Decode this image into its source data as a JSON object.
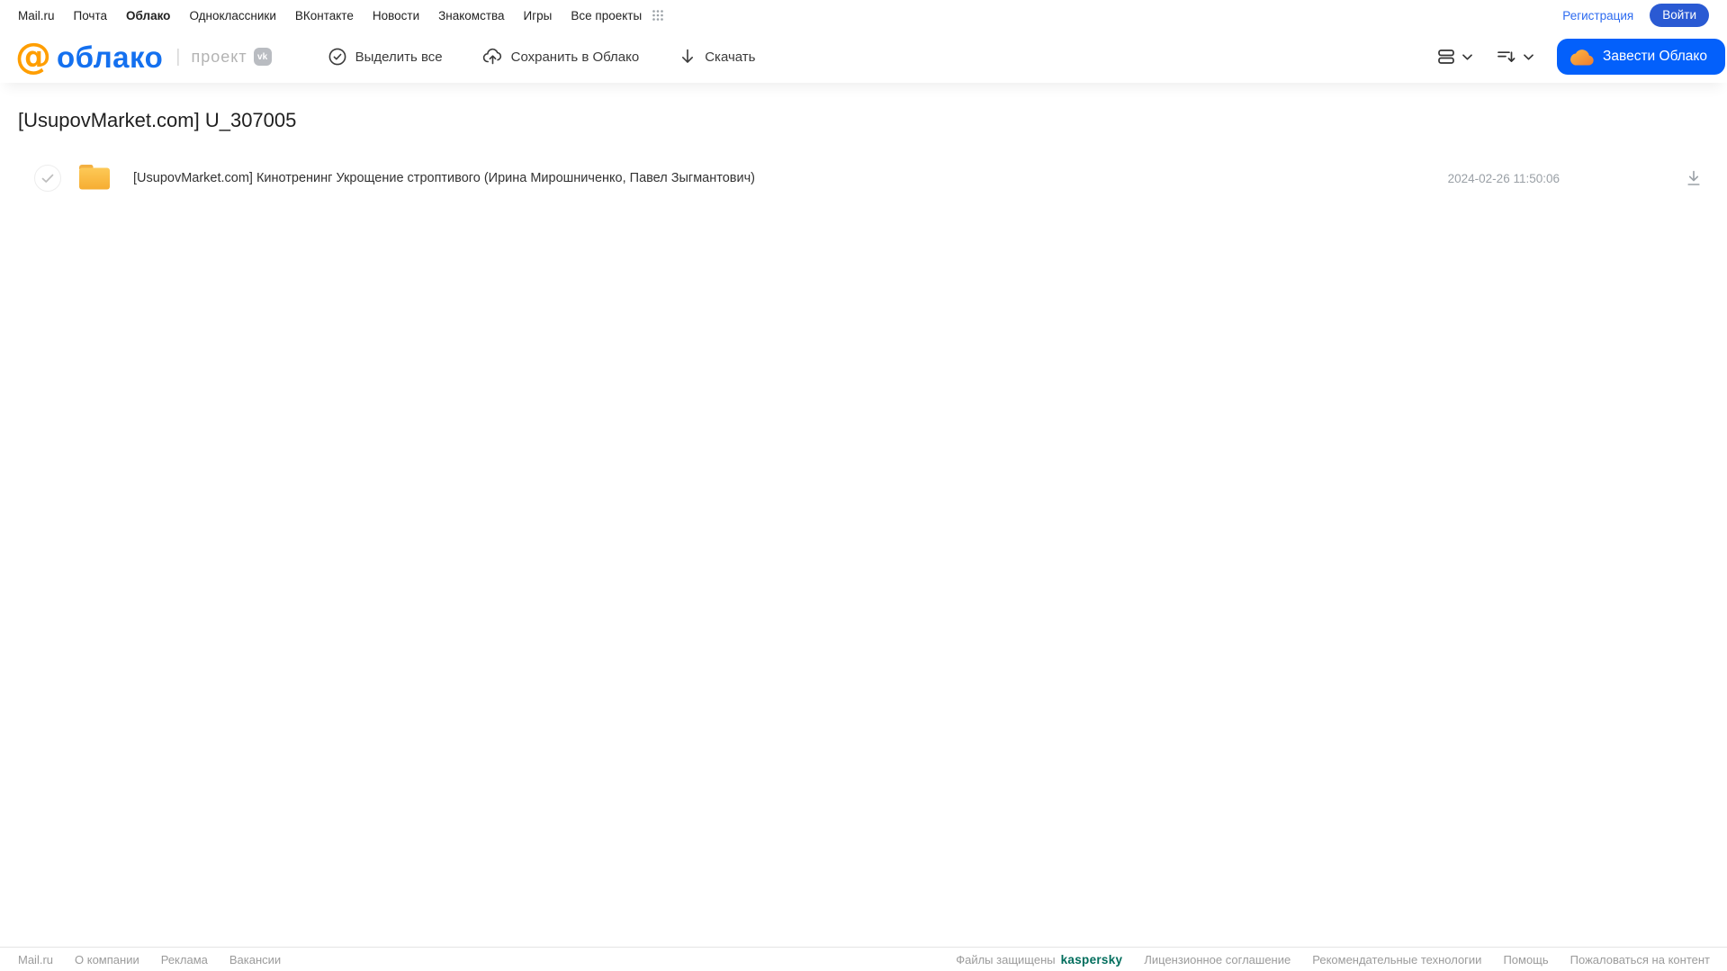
{
  "topnav": {
    "links": [
      {
        "label": "Mail.ru"
      },
      {
        "label": "Почта"
      },
      {
        "label": "Облако"
      },
      {
        "label": "Одноклассники"
      },
      {
        "label": "ВКонтакте"
      },
      {
        "label": "Новости"
      },
      {
        "label": "Знакомства"
      },
      {
        "label": "Игры"
      },
      {
        "label": "Все проекты"
      }
    ],
    "registration_label": "Регистрация",
    "login_label": "Войти"
  },
  "header": {
    "logo_at": "@",
    "logo_text": "облако",
    "project_label": "проект",
    "vk_badge": "vk",
    "toolbar": {
      "select_all": "Выделить все",
      "save_to_cloud": "Сохранить в Облако",
      "download": "Скачать"
    },
    "create_cloud_label": "Завести Облако"
  },
  "content": {
    "title": "[UsupovMarket.com] U_307005",
    "files": [
      {
        "type": "folder",
        "name": "[UsupovMarket.com] Кинотренинг Укрощение строптивого (Ирина Мирошниченко, Павел Зыгмантович)",
        "date": "2024-02-26 11:50:06"
      }
    ]
  },
  "footer": {
    "left_links": [
      "Mail.ru",
      "О компании",
      "Реклама",
      "Вакансии"
    ],
    "protected_label": "Файлы защищены",
    "kaspersky_label": "kaspersky",
    "right_links": [
      "Лицензионное соглашение",
      "Рекомендательные технологии",
      "Помощь",
      "Пожаловаться на контент"
    ]
  },
  "colors": {
    "brand_blue": "#1470ef",
    "brand_orange": "#ff9e00",
    "accent_button_blue": "#0360fb",
    "login_button_blue": "#2a5ad3",
    "kaspersky_green": "#006d5c",
    "folder_yellow_top": "#fdc957",
    "folder_yellow_bottom": "#f6ad32"
  }
}
